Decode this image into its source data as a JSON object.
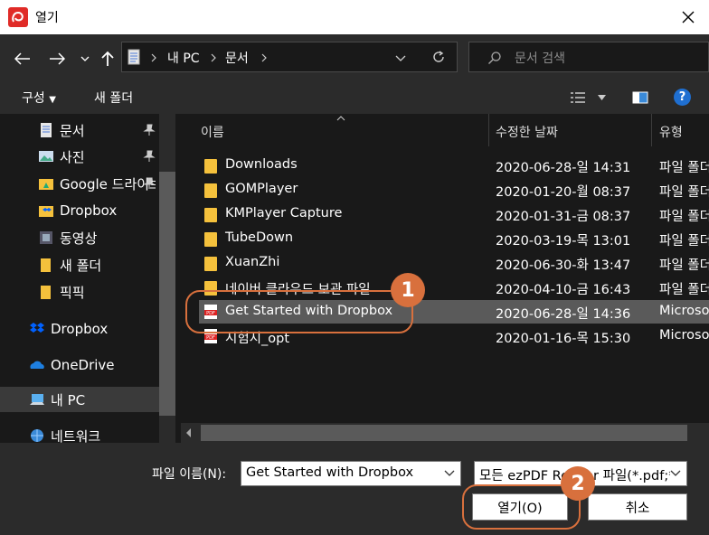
{
  "window": {
    "title": "열기"
  },
  "nav": {
    "breadcrumb": [
      "내 PC",
      "문서"
    ],
    "search_placeholder": "문서 검색"
  },
  "toolbar": {
    "organize": "구성",
    "new_folder": "새 폴더"
  },
  "sidebar": {
    "items": [
      {
        "label": "문서",
        "icon": "document-icon",
        "pinned": true
      },
      {
        "label": "사진",
        "icon": "picture-icon",
        "pinned": true
      },
      {
        "label": "Google 드라이브",
        "icon": "google-drive-icon",
        "pinned": true
      },
      {
        "label": "Dropbox",
        "icon": "dropbox-icon",
        "pinned": false
      },
      {
        "label": "동영상",
        "icon": "video-icon",
        "pinned": false
      },
      {
        "label": "새 폴더",
        "icon": "folder-icon",
        "pinned": false
      },
      {
        "label": "픽픽",
        "icon": "folder-icon",
        "pinned": false
      }
    ],
    "sections": [
      {
        "label": "Dropbox",
        "icon": "dropbox-icon"
      },
      {
        "label": "OneDrive",
        "icon": "onedrive-icon"
      },
      {
        "label": "내 PC",
        "icon": "computer-icon",
        "selected": true
      },
      {
        "label": "네트워크",
        "icon": "network-icon"
      }
    ]
  },
  "columns": {
    "name": "이름",
    "modified": "수정한 날짜",
    "type": "유형"
  },
  "files": [
    {
      "name": "Downloads",
      "modified": "2020-06-28-일 14:31",
      "type": "파일 폴더",
      "icon": "folder-icon"
    },
    {
      "name": "GOMPlayer",
      "modified": "2020-01-20-월 08:37",
      "type": "파일 폴더",
      "icon": "folder-icon"
    },
    {
      "name": "KMPlayer Capture",
      "modified": "2020-01-31-금 08:37",
      "type": "파일 폴더",
      "icon": "folder-icon"
    },
    {
      "name": "TubeDown",
      "modified": "2020-03-19-목 13:01",
      "type": "파일 폴더",
      "icon": "folder-icon"
    },
    {
      "name": "XuanZhi",
      "modified": "2020-06-30-화 13:47",
      "type": "파일 폴더",
      "icon": "folder-icon"
    },
    {
      "name": "네이버 클라우드 보관 파일",
      "modified": "2020-04-10-금 16:43",
      "type": "파일 폴더",
      "icon": "folder-icon"
    },
    {
      "name": "Get Started with Dropbox",
      "modified": "2020-06-28-일 14:36",
      "type": "Microsoft Edge PDF",
      "icon": "pdf-icon",
      "selected": true
    },
    {
      "name": "시험지_opt",
      "modified": "2020-01-16-목 15:30",
      "type": "Microsoft Edge PDF",
      "icon": "pdf-icon"
    }
  ],
  "footer": {
    "filename_label": "파일 이름(N):",
    "filename_value": "Get Started with Dropbox",
    "filter": "모든 ezPDF Reader 파일(*.pdf;*",
    "open_button": "열기(O)",
    "cancel_button": "취소"
  },
  "annotations": [
    "1",
    "2"
  ],
  "colors": {
    "accent": "#d8703d",
    "selection": "#5a5a5a",
    "background": "#191919",
    "panel": "#2b2b2b"
  }
}
